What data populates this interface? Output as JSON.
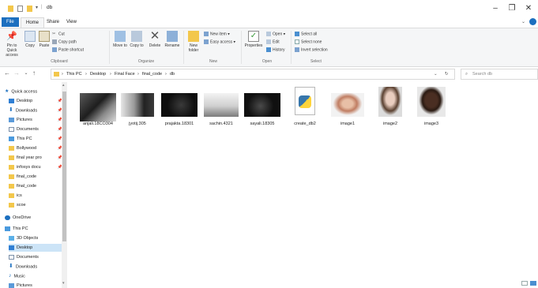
{
  "window": {
    "title": "db",
    "minimize_glyph": "–",
    "maximize_glyph": "❐",
    "close_glyph": "✕"
  },
  "tabs": [
    {
      "label": "File"
    },
    {
      "label": "Home"
    },
    {
      "label": "Share"
    },
    {
      "label": "View"
    }
  ],
  "ribbon": {
    "clipboard": {
      "pin": "Pin to Quick access",
      "copy": "Copy",
      "paste": "Paste",
      "cut": "Cut",
      "copy_path": "Copy path",
      "paste_shortcut": "Paste shortcut",
      "label": "Clipboard"
    },
    "organize": {
      "move_to": "Move to",
      "copy_to": "Copy to",
      "delete": "Delete",
      "rename": "Rename",
      "label": "Organize"
    },
    "new": {
      "new_folder": "New folder",
      "new_item": "New item",
      "easy_access": "Easy access",
      "label": "New"
    },
    "open": {
      "properties": "Properties",
      "open": "Open",
      "edit": "Edit",
      "history": "History",
      "label": "Open"
    },
    "select": {
      "select_all": "Select all",
      "select_none": "Select none",
      "invert": "Invert selection",
      "label": "Select"
    }
  },
  "address": {
    "crumbs": [
      "This PC",
      "Desktop",
      "Final Face",
      "final_code",
      "db"
    ],
    "search_placeholder": "Search db"
  },
  "nav_pane": {
    "quick_access": "Quick access",
    "items": [
      {
        "label": "Desktop",
        "pinned": true,
        "icon": "desktop-folder-icon"
      },
      {
        "label": "Downloads",
        "pinned": true,
        "icon": "download-folder-icon"
      },
      {
        "label": "Pictures",
        "pinned": true,
        "icon": "pictures-folder-icon"
      },
      {
        "label": "Documents",
        "pinned": true,
        "icon": "documents-folder-icon"
      },
      {
        "label": "This PC",
        "pinned": true,
        "icon": "pc-icon"
      },
      {
        "label": "Bollywood",
        "pinned": true,
        "icon": "folder-icon"
      },
      {
        "label": "final year pro",
        "pinned": true,
        "icon": "folder-icon"
      },
      {
        "label": "infosys docu",
        "pinned": true,
        "icon": "folder-icon"
      },
      {
        "label": "final_code",
        "pinned": false,
        "icon": "folder-icon"
      },
      {
        "label": "final_code",
        "pinned": false,
        "icon": "folder-icon"
      },
      {
        "label": "ics",
        "pinned": false,
        "icon": "folder-icon"
      },
      {
        "label": "scoe",
        "pinned": false,
        "icon": "folder-icon"
      }
    ],
    "onedrive": "OneDrive",
    "this_pc": "This PC",
    "pc_items": [
      {
        "label": "3D Objects",
        "icon": "3d-objects-icon"
      },
      {
        "label": "Desktop",
        "icon": "desktop-folder-icon",
        "selected": true
      },
      {
        "label": "Documents",
        "icon": "documents-folder-icon"
      },
      {
        "label": "Downloads",
        "icon": "download-folder-icon"
      },
      {
        "label": "Music",
        "icon": "music-folder-icon"
      },
      {
        "label": "Pictures",
        "icon": "pictures-folder-icon"
      }
    ]
  },
  "files": [
    {
      "name": "anjali.18CO304",
      "kind": "photo-dark"
    },
    {
      "name": "jyotij.305",
      "kind": "photo-dark"
    },
    {
      "name": "prajakta.18301",
      "kind": "photo-black"
    },
    {
      "name": "sachin.4321",
      "kind": "photo-light"
    },
    {
      "name": "sayali.18305",
      "kind": "photo-black"
    },
    {
      "name": "create_db2",
      "kind": "python-file"
    },
    {
      "name": "image1",
      "kind": "portrait-woman"
    },
    {
      "name": "image2",
      "kind": "portrait-woman-dark"
    },
    {
      "name": "image3",
      "kind": "portrait-man"
    }
  ],
  "colors": {
    "accent": "#1c6fbf",
    "folder": "#f3c74b",
    "selection": "#cce4f7"
  }
}
